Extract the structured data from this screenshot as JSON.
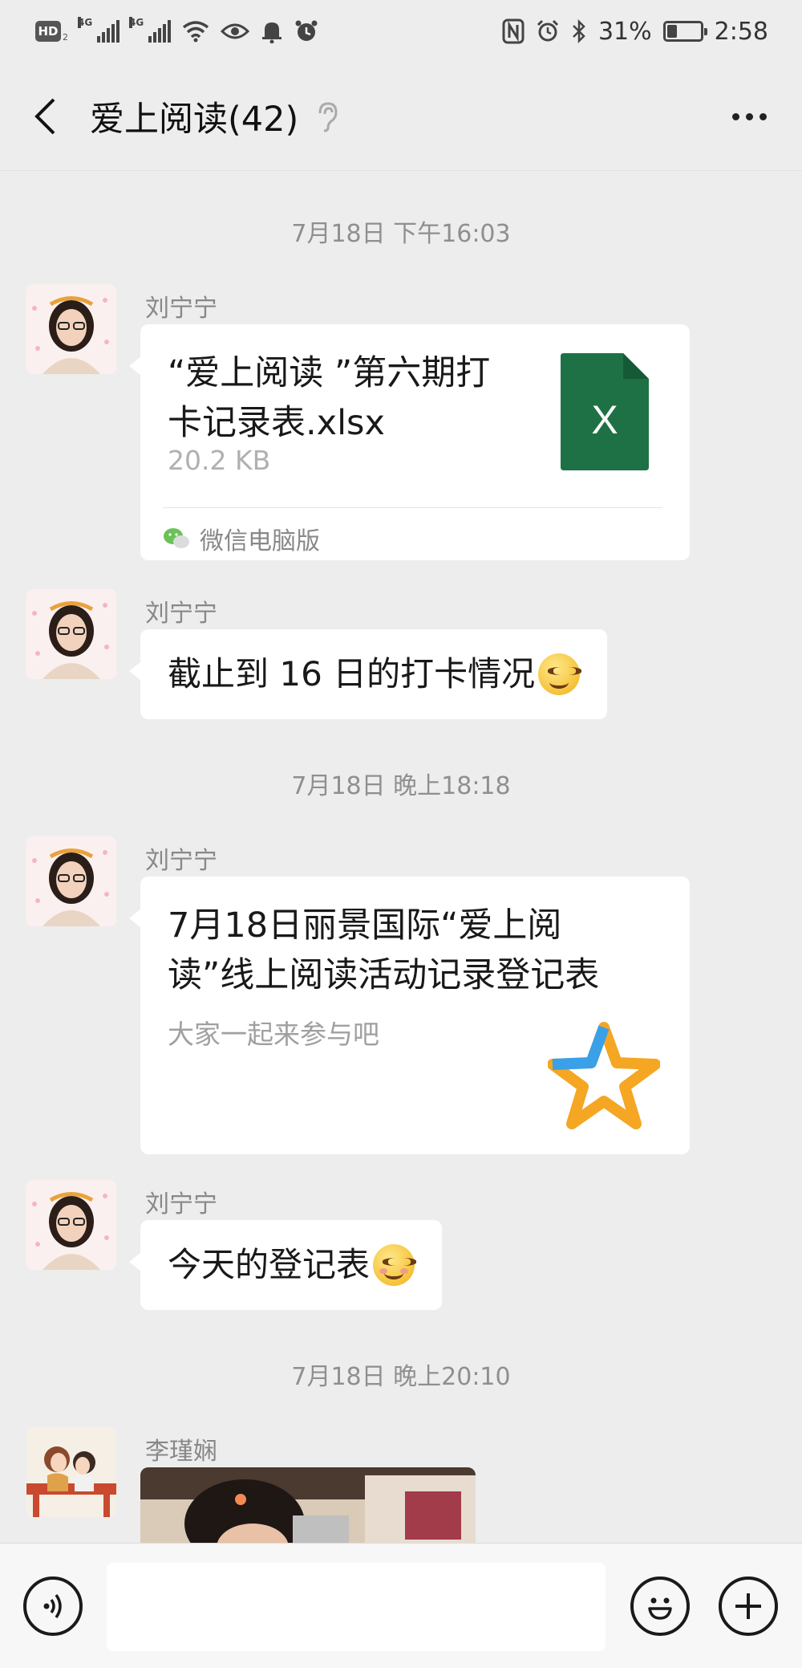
{
  "status_bar": {
    "hd": "HD",
    "sim_sub": "2",
    "net1": "4G",
    "net2": "4G",
    "battery_percent": "31%",
    "battery_level": 0.31,
    "time": "2:58"
  },
  "header": {
    "title": "爱上阅读(42)"
  },
  "messages": {
    "time1": "7月18日 下午16:03",
    "msg1": {
      "sender": "刘宁宁",
      "file_title_line1": "“爱上阅读 ”第六期打",
      "file_title_line2": "卡记录表.xlsx",
      "file_size": "20.2 KB",
      "file_icon_letter": "X",
      "source": "微信电脑版"
    },
    "msg2": {
      "sender": "刘宁宁",
      "text": "截止到 16 日的打卡情况"
    },
    "time2": "7月18日 晚上18:18",
    "msg3": {
      "sender": "刘宁宁",
      "title_line1": "7月18日丽景国际“爱上阅",
      "title_line2": "读”线上阅读活动记录登记表",
      "desc": "大家一起来参与吧"
    },
    "msg4": {
      "sender": "刘宁宁",
      "text": "今天的登记表"
    },
    "time3": "7月18日 晚上20:10",
    "msg5": {
      "sender": "李瑾娴"
    }
  },
  "colors": {
    "excel_green": "#1e7145",
    "star_orange": "#f5a623",
    "star_blue": "#3aa0e8",
    "chat_bg": "#ededed"
  }
}
